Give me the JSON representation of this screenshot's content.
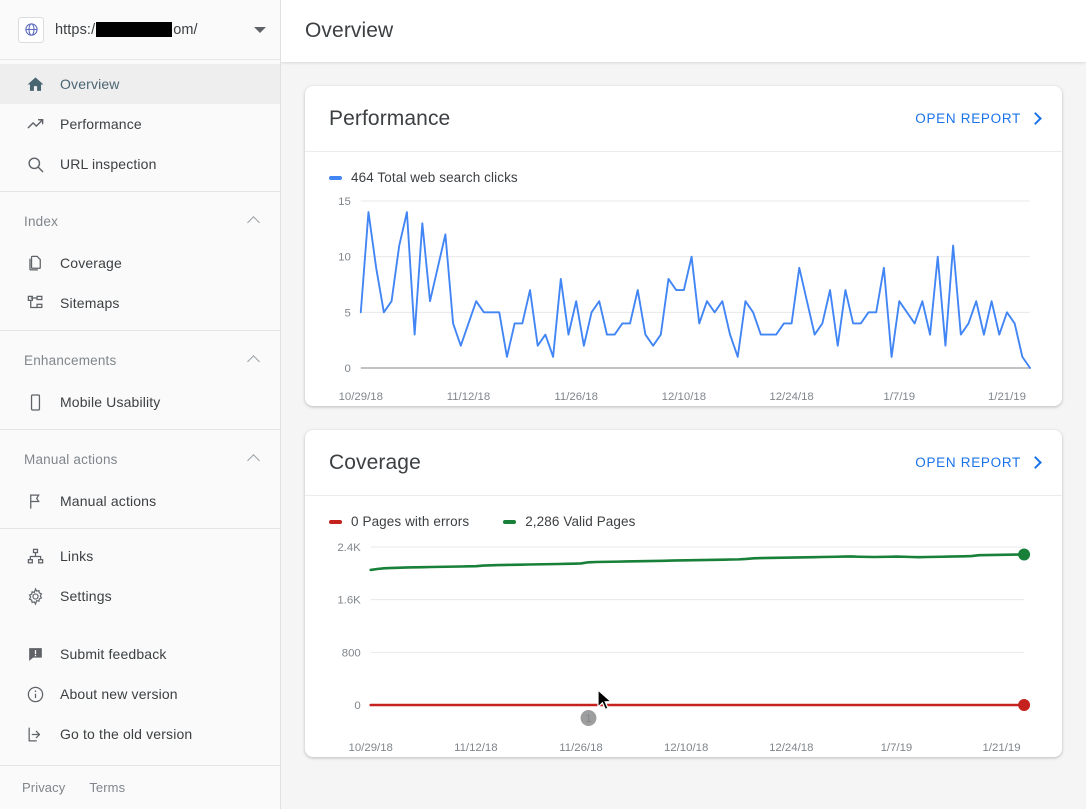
{
  "property": {
    "url_prefix": "https:/",
    "url_suffix": "om/",
    "globe_icon": "globe-icon",
    "dropdown_icon": "chevron-down-icon"
  },
  "header": {
    "title": "Overview"
  },
  "sidebar": {
    "items": [
      {
        "label": "Overview",
        "icon": "home-icon",
        "active": true
      },
      {
        "label": "Performance",
        "icon": "trending-up-icon",
        "active": false
      },
      {
        "label": "URL inspection",
        "icon": "search-icon",
        "active": false
      }
    ],
    "sections": [
      {
        "title": "Index",
        "collapse_icon": "chevron-up-icon",
        "items": [
          {
            "label": "Coverage",
            "icon": "pages-icon"
          },
          {
            "label": "Sitemaps",
            "icon": "sitemap-tree-icon"
          }
        ]
      },
      {
        "title": "Enhancements",
        "collapse_icon": "chevron-up-icon",
        "items": [
          {
            "label": "Mobile Usability",
            "icon": "mobile-phone-icon"
          }
        ]
      },
      {
        "title": "Manual actions",
        "collapse_icon": "chevron-up-icon",
        "items": [
          {
            "label": "Manual actions",
            "icon": "flag-icon"
          }
        ]
      }
    ],
    "links_group": [
      {
        "label": "Links",
        "icon": "links-hierarchy-icon"
      },
      {
        "label": "Settings",
        "icon": "gear-icon"
      }
    ],
    "bottom_group": [
      {
        "label": "Submit feedback",
        "icon": "feedback-icon"
      },
      {
        "label": "About new version",
        "icon": "info-icon"
      },
      {
        "label": "Go to the old version",
        "icon": "exit-arrow-icon"
      }
    ],
    "footer": [
      {
        "label": "Privacy"
      },
      {
        "label": "Terms"
      }
    ]
  },
  "cards": {
    "performance": {
      "title": "Performance",
      "open_report_label": "OPEN REPORT",
      "open_report_icon": "chevron-right-icon",
      "legend": [
        {
          "label": "464 Total web search clicks",
          "color": "#4285f4"
        }
      ]
    },
    "coverage": {
      "title": "Coverage",
      "open_report_label": "OPEN REPORT",
      "open_report_icon": "chevron-right-icon",
      "legend": [
        {
          "label": "0 Pages with errors",
          "color": "#c5221f"
        },
        {
          "label": "2,286 Valid Pages",
          "color": "#188038"
        }
      ],
      "annotation_marker": "1"
    }
  },
  "chart_data": [
    {
      "type": "line",
      "title": "Performance",
      "xlabel": "",
      "ylabel": "",
      "grid": true,
      "legend_position": "top-left",
      "ytick_labels": [
        "0",
        "5",
        "10",
        "15"
      ],
      "yticks": [
        0,
        5,
        10,
        15
      ],
      "ylim": [
        0,
        15
      ],
      "xtick_labels": [
        "10/29/18",
        "11/12/18",
        "11/26/18",
        "12/10/18",
        "12/24/18",
        "1/7/19",
        "1/21/19"
      ],
      "xtick_indices": [
        0,
        14,
        28,
        42,
        56,
        70,
        84
      ],
      "series": [
        {
          "name": "Total web search clicks",
          "color": "#4285f4",
          "total": 464,
          "values": [
            5,
            14,
            9,
            5,
            6,
            11,
            14,
            3,
            13,
            6,
            9,
            12,
            4,
            2,
            4,
            6,
            5,
            5,
            5,
            1,
            4,
            4,
            7,
            2,
            3,
            1,
            8,
            3,
            6,
            2,
            5,
            6,
            3,
            3,
            4,
            4,
            7,
            3,
            2,
            3,
            8,
            7,
            7,
            10,
            4,
            6,
            5,
            6,
            3,
            1,
            6,
            5,
            3,
            3,
            3,
            4,
            4,
            9,
            6,
            3,
            4,
            7,
            2,
            7,
            4,
            4,
            5,
            5,
            9,
            1,
            6,
            5,
            4,
            6,
            3,
            10,
            2,
            11,
            3,
            4,
            6,
            3,
            6,
            3,
            5,
            4,
            1,
            0
          ]
        }
      ]
    },
    {
      "type": "line",
      "title": "Coverage",
      "xlabel": "",
      "ylabel": "",
      "grid": true,
      "legend_position": "top-left",
      "ytick_labels": [
        "0",
        "800",
        "1.6K",
        "2.4K"
      ],
      "yticks": [
        0,
        800,
        1600,
        2400
      ],
      "ylim": [
        0,
        2400
      ],
      "xtick_labels": [
        "10/29/18",
        "11/12/18",
        "11/26/18",
        "12/10/18",
        "12/24/18",
        "1/7/19",
        "1/21/19"
      ],
      "xtick_indices": [
        0,
        14,
        28,
        42,
        56,
        70,
        84
      ],
      "annotations": [
        {
          "label": "1",
          "x_index": 29
        }
      ],
      "series": [
        {
          "name": "Valid Pages",
          "color": "#188038",
          "end_value": 2286,
          "end_marker": true,
          "values": [
            2052,
            2068,
            2078,
            2082,
            2086,
            2090,
            2092,
            2094,
            2096,
            2098,
            2100,
            2102,
            2104,
            2106,
            2108,
            2118,
            2122,
            2126,
            2128,
            2130,
            2132,
            2134,
            2136,
            2138,
            2140,
            2142,
            2144,
            2146,
            2150,
            2168,
            2172,
            2174,
            2176,
            2178,
            2180,
            2182,
            2184,
            2186,
            2188,
            2190,
            2194,
            2196,
            2198,
            2200,
            2202,
            2204,
            2206,
            2208,
            2210,
            2212,
            2218,
            2228,
            2232,
            2234,
            2236,
            2238,
            2240,
            2242,
            2244,
            2246,
            2248,
            2250,
            2252,
            2254,
            2256,
            2252,
            2250,
            2248,
            2250,
            2252,
            2254,
            2252,
            2248,
            2246,
            2248,
            2250,
            2252,
            2254,
            2256,
            2258,
            2262,
            2276,
            2278,
            2280,
            2282,
            2284,
            2285,
            2286
          ]
        },
        {
          "name": "Pages with errors",
          "color": "#c5221f",
          "end_value": 0,
          "end_marker": true,
          "values": [
            0,
            0,
            0,
            0,
            0,
            0,
            0,
            0,
            0,
            0,
            0,
            0,
            0,
            0,
            0,
            0,
            0,
            0,
            0,
            0,
            0,
            0,
            0,
            0,
            0,
            0,
            0,
            0,
            0,
            0,
            0,
            0,
            0,
            0,
            0,
            0,
            0,
            0,
            0,
            0,
            0,
            0,
            0,
            0,
            0,
            0,
            0,
            0,
            0,
            0,
            0,
            0,
            0,
            0,
            0,
            0,
            0,
            0,
            0,
            0,
            0,
            0,
            0,
            0,
            0,
            0,
            0,
            0,
            0,
            0,
            0,
            0,
            0,
            0,
            0,
            0,
            0,
            0,
            0,
            0,
            0,
            0,
            0,
            0,
            0,
            0,
            0,
            0
          ]
        }
      ]
    }
  ]
}
